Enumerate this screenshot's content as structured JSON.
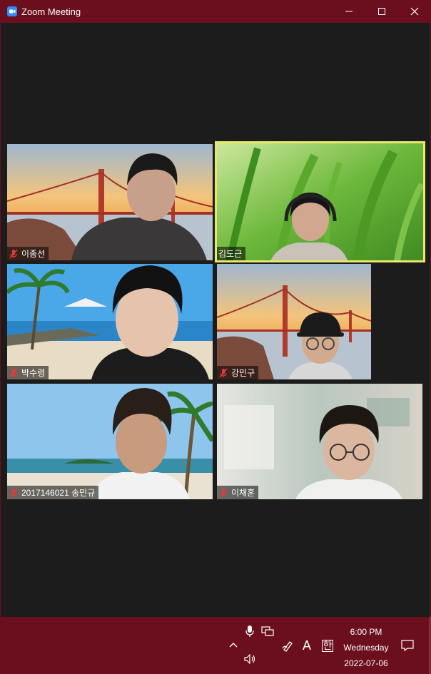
{
  "window": {
    "title": "Zoom Meeting",
    "icon": "zoom-camera-icon"
  },
  "participants": [
    {
      "name": "이종선",
      "muted": true,
      "background": "golden-gate-bridge"
    },
    {
      "name": "김도근",
      "muted": false,
      "active_speaker": true,
      "background": "grass"
    },
    {
      "name": "박수령",
      "muted": true,
      "background": "beach-palm"
    },
    {
      "name": "강민구",
      "muted": true,
      "background": "golden-gate-bridge"
    },
    {
      "name": "2017146021 송민규",
      "muted": true,
      "background": "tropical-beach"
    },
    {
      "name": "이채훈",
      "muted": true,
      "background": "room-blurred"
    }
  ],
  "taskbar": {
    "time": "6:00 PM",
    "day": "Wednesday",
    "date": "2022-07-06",
    "ime_label": "A",
    "ime_korean": "한",
    "icons": [
      "chevron-up-icon",
      "microphone-icon",
      "network-icon",
      "volume-icon",
      "pen-icon",
      "notification-icon"
    ]
  },
  "colors": {
    "accent": "#6b0f1e",
    "stage": "#1c1c1c",
    "active_border": "#e8e86a"
  }
}
